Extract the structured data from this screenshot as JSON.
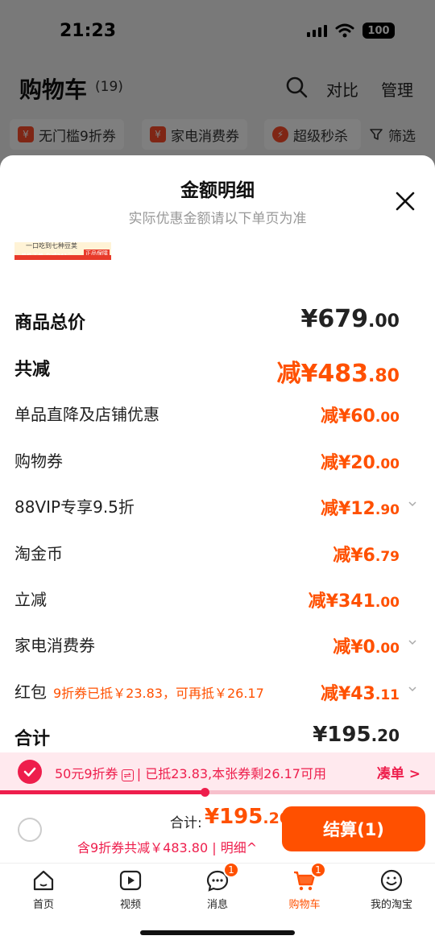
{
  "status": {
    "time": "21:23",
    "battery": "100"
  },
  "header": {
    "title": "购物车",
    "count": "(19)",
    "compare": "对比",
    "manage": "管理"
  },
  "chips": [
    {
      "icon": "¥",
      "label": "无门槛9折券"
    },
    {
      "icon": "¥",
      "label": "家电消费券"
    },
    {
      "icon": "⚡",
      "label": "超级秒杀"
    }
  ],
  "filter_label": "筛选",
  "sheet": {
    "title": "金额明细",
    "subtitle": "实际优惠金额请以下单页为准",
    "banner_top": "一口吃到七种豆荚",
    "banner_bottom": "单件下单 立减341元",
    "banner_tag": "正品保障"
  },
  "rows": [
    {
      "label": "商品总价",
      "amount": "¥679",
      "decimal": ".00"
    },
    {
      "label": "共减",
      "amount": "减¥483",
      "decimal": ".80"
    },
    {
      "label": "单品直降及店铺优惠",
      "amount": "减¥60",
      "decimal": ".00"
    },
    {
      "label": "购物券",
      "amount": "减¥20",
      "decimal": ".00"
    },
    {
      "label": "88VIP专享9.5折",
      "amount": "减¥12",
      "decimal": ".90"
    },
    {
      "label": "淘金币",
      "amount": "减¥6",
      "decimal": ".79"
    },
    {
      "label": "立减",
      "amount": "减¥341",
      "decimal": ".00"
    },
    {
      "label": "家电消费券",
      "amount": "减¥0",
      "decimal": ".00"
    },
    {
      "label": "红包",
      "note": "9折券已抵￥23.83，可再抵￥26.17",
      "amount": "减¥43",
      "decimal": ".11"
    },
    {
      "label": "合计",
      "amount": "¥195",
      "decimal": ".20"
    }
  ],
  "coupon_bar": {
    "coupon": "50元9折券",
    "swap_icon": "⇌",
    "status": "已抵23.83,本张券剩26.17可用",
    "link": "凑单 >",
    "progress": 0.47
  },
  "footer": {
    "total_label": "合计:",
    "total": "¥195",
    "total_decimal": ".20",
    "detail": "含9折券共减￥483.80",
    "detail_link": "明细^",
    "checkout": "结算(1)"
  },
  "tabs": [
    {
      "label": "首页",
      "icon": "home-icon"
    },
    {
      "label": "视频",
      "icon": "video-icon"
    },
    {
      "label": "消息",
      "icon": "message-icon",
      "badge": "1"
    },
    {
      "label": "购物车",
      "icon": "cart-icon",
      "badge": "1",
      "active": true
    },
    {
      "label": "我的淘宝",
      "icon": "profile-icon"
    }
  ],
  "colors": {
    "accent": "#ff5000",
    "coupon": "#ee1e4c"
  }
}
